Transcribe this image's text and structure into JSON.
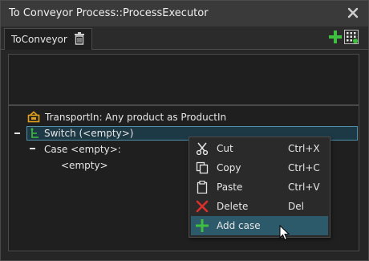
{
  "window": {
    "title": "To Conveyor Process::ProcessExecutor"
  },
  "tab": {
    "label": "ToConveyor"
  },
  "tree": {
    "transport_in": "TransportIn: Any product as ProductIn",
    "switch": "Switch (<empty>)",
    "case": "Case <empty>:",
    "empty": "<empty>"
  },
  "context_menu": {
    "items": [
      {
        "label": "Cut",
        "shortcut": "Ctrl+X",
        "icon": "scissors-icon"
      },
      {
        "label": "Copy",
        "shortcut": "Ctrl+C",
        "icon": "copy-icon"
      },
      {
        "label": "Paste",
        "shortcut": "Ctrl+V",
        "icon": "paste-icon"
      },
      {
        "label": "Delete",
        "shortcut": "Del",
        "icon": "delete-icon"
      },
      {
        "label": "Add case",
        "shortcut": "",
        "icon": "add-icon"
      }
    ],
    "highlighted_item": "Add case"
  },
  "colors": {
    "selection": "#2c5a6b",
    "accent_green": "#3fbf3f",
    "delete_red": "#d9302c",
    "icon_orange": "#e2a01b"
  }
}
